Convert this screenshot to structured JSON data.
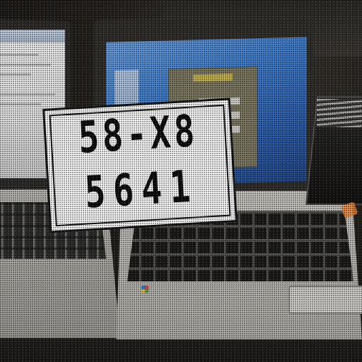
{
  "scene": {
    "description_free": true
  },
  "plate": {
    "line1": "58-X8",
    "line2": "5641"
  },
  "colors": {
    "plate_background": "#fbfbfb",
    "plate_text": "#0d0d0d",
    "laptop_screen_blue": "#3f7fd0",
    "dialog_olive": "#7e7a62"
  },
  "icons": {
    "windows_key": "windows-logo-icon"
  }
}
